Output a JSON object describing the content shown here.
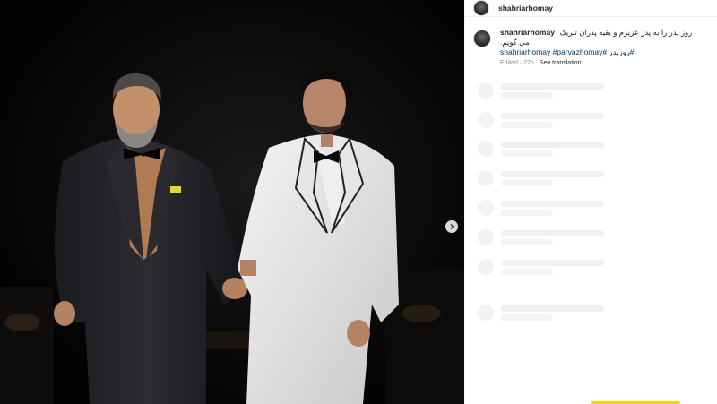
{
  "header": {
    "username": "shahriarhomay"
  },
  "caption": {
    "username": "shahriarhomay",
    "text": "روز پدر را به پدر عزیزم و بقیه پدران تبریک می گویم.",
    "hashtags": "#روزپدر #shahriarhomay #parvazhomay",
    "edited": "Edited",
    "time": "22h",
    "see_translation": "See translation"
  },
  "icons": {
    "avatar": "profile-avatar",
    "next": "chevron-right-icon"
  },
  "colors": {
    "link": "#00376b",
    "muted": "#8e8e8e",
    "text": "#262626",
    "skeleton": "#f0f0f0",
    "media_bg": "#050505"
  },
  "skeleton_rows": 7
}
